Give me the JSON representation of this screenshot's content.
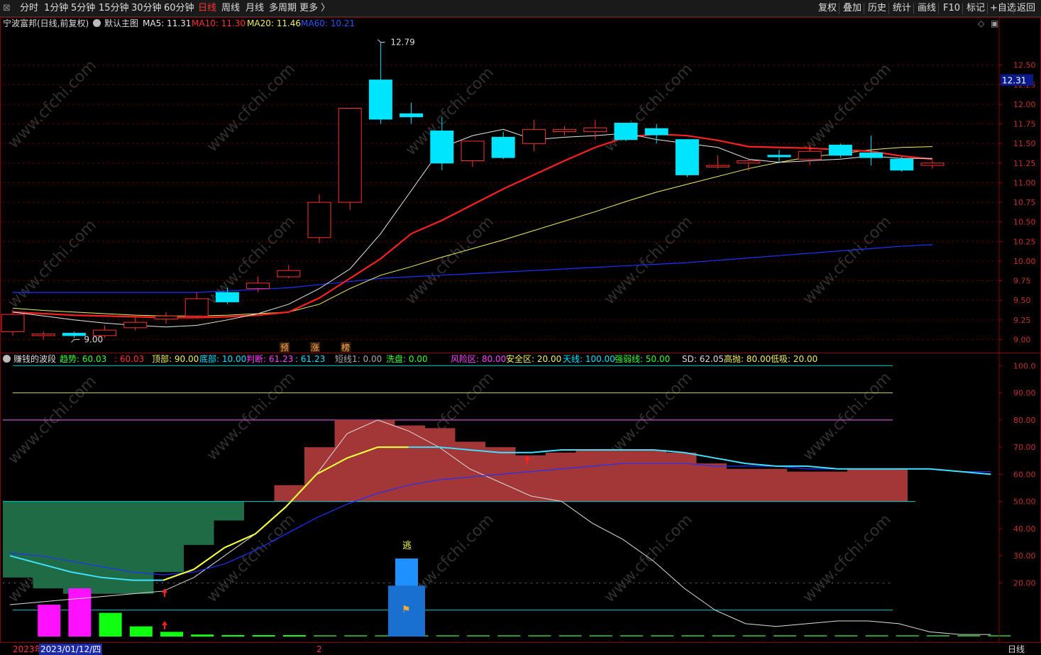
{
  "toolbar": {
    "menu_glyph": "⊠",
    "periods": [
      "分时",
      "1分钟",
      "5分钟",
      "15分钟",
      "30分钟",
      "60分钟",
      "日线",
      "周线",
      "月线",
      "多周期",
      "更多 〉"
    ],
    "active_period": "日线",
    "right_buttons": [
      "复权",
      "叠加",
      "历史",
      "统计",
      "画线",
      "F10",
      "标记",
      "+自选",
      "返回"
    ]
  },
  "main_header": {
    "stock_name": "宁波富邦(日线,前复权)",
    "theme_icon": "settings-circle-icon",
    "main_chart_label": "默认主图",
    "ma5": "MA5: 11.31",
    "ma10": "MA10: 11.30",
    "ma20": "MA20: 11.46",
    "ma60": "MA60: 10.21",
    "right_icons": [
      "◇",
      "▣"
    ]
  },
  "colors": {
    "up": "#ff3030",
    "down": "#00e5ff",
    "ma5": "#e8e8e8",
    "ma10": "#ff2020",
    "ma20": "#f0f060",
    "ma60": "#2030ff",
    "axis": "#8b0000",
    "price_tag_bg": "#0a1a8a"
  },
  "price_axis": {
    "ticks": [
      "12.50",
      "12.25",
      "12.00",
      "11.75",
      "11.50",
      "11.25",
      "11.00",
      "10.75",
      "10.50",
      "10.25",
      "10.00",
      "9.75",
      "9.50",
      "9.25",
      "9.00"
    ],
    "current_price": "12.31"
  },
  "annotations": {
    "high_label": "12.79",
    "low_label": "9.00",
    "signal_labels": [
      "预",
      "涨",
      "榜"
    ]
  },
  "chart_data": {
    "type": "candlestick",
    "ylim": [
      8.85,
      12.95
    ],
    "candles": [
      {
        "o": 9.1,
        "h": 9.38,
        "l": 9.05,
        "c": 9.32
      },
      {
        "o": 9.05,
        "h": 9.1,
        "l": 9.0,
        "c": 9.07
      },
      {
        "o": 9.08,
        "h": 9.1,
        "l": 9.02,
        "c": 9.05
      },
      {
        "o": 9.05,
        "h": 9.18,
        "l": 9.02,
        "c": 9.12
      },
      {
        "o": 9.15,
        "h": 9.28,
        "l": 9.12,
        "c": 9.22
      },
      {
        "o": 9.26,
        "h": 9.35,
        "l": 9.2,
        "c": 9.3
      },
      {
        "o": 9.3,
        "h": 9.6,
        "l": 9.28,
        "c": 9.52
      },
      {
        "o": 9.6,
        "h": 9.66,
        "l": 9.45,
        "c": 9.48
      },
      {
        "o": 9.65,
        "h": 9.8,
        "l": 9.6,
        "c": 9.72
      },
      {
        "o": 9.8,
        "h": 9.95,
        "l": 9.78,
        "c": 9.88
      },
      {
        "o": 10.3,
        "h": 10.85,
        "l": 10.23,
        "c": 10.75
      },
      {
        "o": 10.75,
        "h": 11.95,
        "l": 10.65,
        "c": 11.95
      },
      {
        "o": 12.31,
        "h": 12.79,
        "l": 11.75,
        "c": 11.81
      },
      {
        "o": 11.88,
        "h": 12.02,
        "l": 11.75,
        "c": 11.84
      },
      {
        "o": 11.66,
        "h": 11.84,
        "l": 11.16,
        "c": 11.25
      },
      {
        "o": 11.28,
        "h": 11.53,
        "l": 11.2,
        "c": 11.53
      },
      {
        "o": 11.58,
        "h": 11.65,
        "l": 11.3,
        "c": 11.32
      },
      {
        "o": 11.5,
        "h": 11.8,
        "l": 11.4,
        "c": 11.68
      },
      {
        "o": 11.65,
        "h": 11.72,
        "l": 11.6,
        "c": 11.68
      },
      {
        "o": 11.65,
        "h": 11.8,
        "l": 11.55,
        "c": 11.7
      },
      {
        "o": 11.76,
        "h": 11.76,
        "l": 11.53,
        "c": 11.55
      },
      {
        "o": 11.69,
        "h": 11.75,
        "l": 11.5,
        "c": 11.61
      },
      {
        "o": 11.55,
        "h": 11.55,
        "l": 11.07,
        "c": 11.1
      },
      {
        "o": 11.2,
        "h": 11.35,
        "l": 11.18,
        "c": 11.22
      },
      {
        "o": 11.25,
        "h": 11.3,
        "l": 11.15,
        "c": 11.28
      },
      {
        "o": 11.35,
        "h": 11.42,
        "l": 11.25,
        "c": 11.33
      },
      {
        "o": 11.3,
        "h": 11.48,
        "l": 11.22,
        "c": 11.4
      },
      {
        "o": 11.48,
        "h": 11.5,
        "l": 11.32,
        "c": 11.35
      },
      {
        "o": 11.38,
        "h": 11.6,
        "l": 11.22,
        "c": 11.32
      },
      {
        "o": 11.3,
        "h": 11.33,
        "l": 11.14,
        "c": 11.16
      },
      {
        "o": 11.22,
        "h": 11.28,
        "l": 11.18,
        "c": 11.25
      }
    ],
    "ma5": [
      9.35,
      9.3,
      9.25,
      9.21,
      9.18,
      9.16,
      9.18,
      9.25,
      9.33,
      9.45,
      9.65,
      9.9,
      10.35,
      10.9,
      11.45,
      11.6,
      11.68,
      11.55,
      11.58,
      11.6,
      11.63,
      11.55,
      11.5,
      11.45,
      11.3,
      11.26,
      11.28,
      11.3,
      11.34,
      11.31,
      11.31
    ],
    "ma10": [
      9.35,
      9.33,
      9.31,
      9.3,
      9.29,
      9.28,
      9.28,
      9.29,
      9.31,
      9.35,
      9.53,
      9.78,
      10.03,
      10.35,
      10.52,
      10.72,
      10.92,
      11.1,
      11.28,
      11.45,
      11.58,
      11.62,
      11.6,
      11.54,
      11.46,
      11.45,
      11.44,
      11.42,
      11.4,
      11.34,
      11.3
    ],
    "ma20": [
      9.4,
      9.37,
      9.35,
      9.33,
      9.31,
      9.3,
      9.3,
      9.31,
      9.33,
      9.35,
      9.45,
      9.65,
      9.82,
      9.93,
      10.05,
      10.16,
      10.27,
      10.39,
      10.51,
      10.63,
      10.76,
      10.88,
      10.98,
      11.08,
      11.18,
      11.26,
      11.33,
      11.37,
      11.42,
      11.45,
      11.46
    ],
    "ma60": [
      9.6,
      9.6,
      9.6,
      9.6,
      9.6,
      9.6,
      9.6,
      9.62,
      9.64,
      9.66,
      9.7,
      9.74,
      9.78,
      9.8,
      9.82,
      9.84,
      9.86,
      9.88,
      9.9,
      9.92,
      9.94,
      9.96,
      9.98,
      10.01,
      10.04,
      10.07,
      10.1,
      10.13,
      10.16,
      10.19,
      10.21
    ]
  },
  "indicator_header": {
    "name": "赚钱的波段",
    "trend": "趋势: 60.03",
    "trend2": ": 60.03",
    "top": "顶部: 90.00",
    "bottom": "底部: 10.00",
    "judge": "判断: 61.23",
    "judge2": ": 61.23",
    "short": "短线1: 0.00",
    "wash": "洗盘: 0.00",
    "risk": "风险区: 80.00",
    "safe": "安全区: 20.00",
    "sky": "天线: 100.00",
    "strong": "强弱线: 50.00",
    "sd": "SD: 62.05",
    "high_throw": "高抛: 80.00",
    "low_buy": "低吸: 20.00"
  },
  "indicator_axis": {
    "ticks": [
      "100.0",
      "90.00",
      "80.00",
      "70.00",
      "60.00",
      "50.00",
      "40.00",
      "30.00",
      "20.00"
    ],
    "escape_label": "逃"
  },
  "indicator_data": {
    "ylim": [
      0,
      104
    ],
    "band": [
      22,
      18,
      16,
      16,
      16,
      24,
      34,
      43,
      50,
      56,
      70,
      80,
      80,
      78,
      77,
      72,
      70,
      67,
      68,
      69,
      69,
      69,
      68,
      64,
      62,
      62,
      61,
      61,
      62,
      62,
      62,
      61,
      60
    ],
    "trend": [
      30,
      27,
      24,
      22,
      21,
      21,
      25,
      33,
      38,
      48,
      60,
      66,
      70,
      70,
      70,
      69,
      68,
      68,
      69,
      69,
      69,
      69,
      68,
      66,
      64,
      63,
      63,
      62,
      62,
      62,
      62,
      61,
      60
    ],
    "judge": [
      12,
      13,
      14,
      15,
      16,
      17,
      22,
      30,
      38,
      48,
      60,
      75,
      80,
      76,
      70,
      62,
      57,
      52,
      50,
      42,
      36,
      28,
      18,
      10,
      5,
      4,
      5,
      6,
      6,
      5,
      2,
      1,
      1
    ],
    "blue_line": [
      31,
      30,
      28,
      26,
      24,
      23,
      24,
      27,
      32,
      38,
      44,
      49,
      53,
      56,
      58,
      59,
      60,
      61,
      62,
      63,
      64,
      64,
      64,
      63,
      63,
      63,
      62,
      62,
      62,
      62,
      62,
      61,
      61
    ],
    "bars_magenta": [
      0,
      12,
      18,
      0,
      0,
      0,
      0,
      0,
      0,
      0,
      0,
      0,
      0,
      0,
      0,
      0,
      0,
      0,
      0,
      0,
      0,
      0,
      0,
      0,
      0,
      0,
      0,
      0,
      0,
      0,
      0,
      0,
      0
    ],
    "bars_green": [
      0,
      0,
      0,
      9,
      4,
      2,
      1,
      0.8,
      0.6,
      0.5,
      0.4,
      0.4,
      0.3,
      0.3,
      0.3,
      0.3,
      0.3,
      0.3,
      0.3,
      0.3,
      0.3,
      0.3,
      0.3,
      0.3,
      0.3,
      0.3,
      0.3,
      0.3,
      0.3,
      0.3,
      0.3,
      0.3,
      0.3
    ],
    "levels": {
      "sky": 100,
      "top": 90,
      "risk": 80,
      "strong": 50,
      "safe": 20,
      "low": 10
    }
  },
  "footer": {
    "year_label": "2023年",
    "date_label": "2023/01/12/四",
    "mark": "2",
    "period_tab": "日线"
  },
  "watermark": "www.cfchi.com"
}
